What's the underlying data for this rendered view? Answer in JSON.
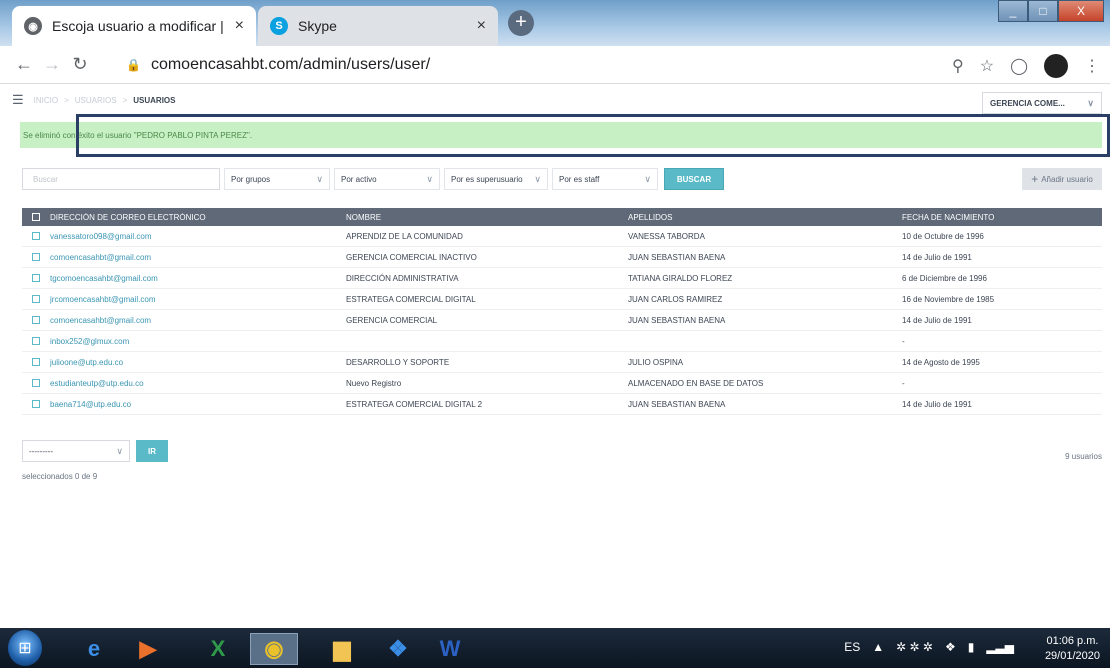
{
  "browser": {
    "tabs": [
      {
        "label": "Escoja usuario a modificar | Sitio",
        "close": "×"
      },
      {
        "label": "Skype",
        "close": "×"
      }
    ],
    "new_tab": "+",
    "url": "comoencasahbt.com/admin/users/user/",
    "window_buttons": {
      "minimize": "_",
      "maximize": "□",
      "close": "X"
    }
  },
  "admin": {
    "breadcrumbs": [
      "INICIO",
      "USUARIOS",
      "USUARIOS"
    ],
    "breadcrumb_sep": ">",
    "user_menu": "GERENCIA COME...",
    "message": "Se eliminó con éxito el usuario \"PEDRO PABLO PINTA PEREZ\".",
    "search_placeholder": "Buscar",
    "filters": [
      "Por grupos",
      "Por activo",
      "Por es superusuario",
      "Por es staff"
    ],
    "buscar_label": "BUSCAR",
    "add_label": "Añadir usuario",
    "columns": [
      "DIRECCIÓN DE CORREO ELECTRÓNICO",
      "NOMBRE",
      "APELLIDOS",
      "FECHA DE NACIMIENTO"
    ],
    "rows": [
      [
        "vanessatoro098@gmail.com",
        "APRENDIZ DE LA COMUNIDAD",
        "VANESSA TABORDA",
        "10 de Octubre de 1996"
      ],
      [
        "comoencasahbt@gmail.com",
        "GERENCIA COMERCIAL INACTIVO",
        "JUAN SEBASTIAN BAENA",
        "14 de Julio de 1991"
      ],
      [
        "tgcomoencasahbt@gmail.com",
        "DIRECCIÓN ADMINISTRATIVA",
        "TATIANA GIRALDO FLOREZ",
        "6 de Diciembre de 1996"
      ],
      [
        "jrcomoencasahbt@gmail.com",
        "ESTRATEGA COMERCIAL DIGITAL",
        "JUAN CARLOS RAMIREZ",
        "16 de Noviembre de 1985"
      ],
      [
        "comoencasahbt@gmail.com",
        "GERENCIA COMERCIAL",
        "JUAN SEBASTIAN BAENA",
        "14 de Julio de 1991"
      ],
      [
        "inbox252@glmux.com",
        "",
        "",
        "-"
      ],
      [
        "julioone@utp.edu.co",
        "DESARROLLO Y SOPORTE",
        "JULIO OSPINA",
        "14 de Agosto de 1995"
      ],
      [
        "estudianteutp@utp.edu.co",
        "Nuevo Registro",
        "ALMACENADO EN BASE DE DATOS",
        "-"
      ],
      [
        "baena714@utp.edu.co",
        "ESTRATEGA COMERCIAL DIGITAL 2",
        "JUAN SEBASTIAN BAENA",
        "14 de Julio de 1991"
      ]
    ],
    "action_value": "---------",
    "ir_label": "IR",
    "count_text": "9 usuarios",
    "selected_text": "seleccionados 0 de 9"
  },
  "taskbar": {
    "language": "ES",
    "time": "01:06 p.m.",
    "date": "29/01/2020"
  }
}
